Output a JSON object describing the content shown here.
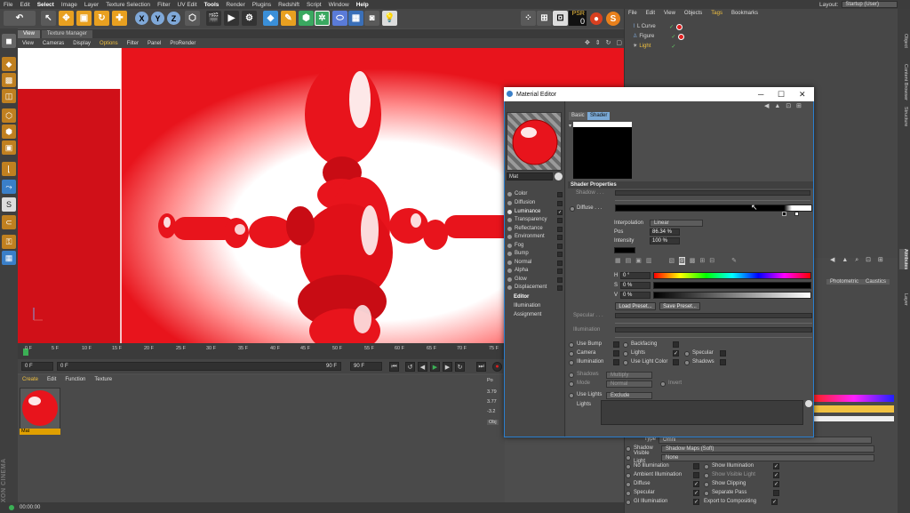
{
  "menubar": {
    "items": [
      "File",
      "Edit",
      "Select",
      "Image",
      "Layer",
      "Texture Selection",
      "Filter",
      "UV Edit",
      "Tools",
      "Render",
      "Plugins",
      "Redshift",
      "Script",
      "Window",
      "Help"
    ],
    "layout_label": "Layout:",
    "layout_value": "Startup (User)"
  },
  "toolbar": {
    "psr_label": "PSR",
    "psr_value": "0"
  },
  "viewport": {
    "tabs": [
      "View",
      "Texture Manager"
    ],
    "menu": [
      "View",
      "Cameras",
      "Display",
      "Options",
      "Filter",
      "Panel",
      "ProRender"
    ]
  },
  "timeline": {
    "ticks": [
      "0 F",
      "5 F",
      "10 F",
      "15 F",
      "20 F",
      "25 F",
      "30 F",
      "35 F",
      "40 F",
      "45 F",
      "50 F",
      "55 F",
      "60 F",
      "65 F",
      "70 F",
      "75 F"
    ],
    "start_frame": "0 F",
    "current_frame": "0 F",
    "end_a": "90 F",
    "end_b": "90 F"
  },
  "material_manager": {
    "menu": [
      "Create",
      "Edit",
      "Function",
      "Texture"
    ],
    "material_name": "Mat"
  },
  "coords": {
    "header": "Po",
    "x": "3.79",
    "y": "3.77",
    "z": "-3.2",
    "button": "Obj"
  },
  "brand": "MAXON CINEMA 4D",
  "statusbar": {
    "time": "00:00:00"
  },
  "object_manager": {
    "menu": [
      "File",
      "Edit",
      "View",
      "Objects",
      "Tags",
      "Bookmarks"
    ],
    "objects": [
      "L Curve",
      "Figure",
      "Light"
    ]
  },
  "side_tabs": [
    "Object",
    "Content Browser",
    "Structure",
    "Attributes",
    "Layer"
  ],
  "attributes": {
    "tabs_visible": [
      "Photometric",
      "Caustics"
    ],
    "type_label": "Type",
    "type_value": "Omni",
    "shadow_label": "Shadow",
    "shadow_value": "Shadow Maps (Soft)",
    "visible_light_label": "Visible Light",
    "visible_light_value": "None",
    "checks_left": [
      "No Illumination",
      "Ambient Illumination",
      "Diffuse",
      "Specular",
      "GI Illumination"
    ],
    "checks_right": [
      "Show Illumination",
      "Show Visible Light",
      "Show Clipping",
      "Separate Pass",
      "Export to Compositing"
    ]
  },
  "material_editor": {
    "title": "Material Editor",
    "material_name": "Mat",
    "tabs": [
      "Basic",
      "Shader"
    ],
    "channels": [
      "Color",
      "Diffusion",
      "Luminance",
      "Transparency",
      "Reflectance",
      "Environment",
      "Fog",
      "Bump",
      "Normal",
      "Alpha",
      "Glow",
      "Displacement"
    ],
    "extra_items": [
      "Editor",
      "Illumination",
      "Assignment"
    ],
    "section_title": "Shader Properties",
    "shadow_label": "Shadow . . .",
    "diffuse_label": "Diffuse . . .",
    "interpolation_label": "Interpolation",
    "interpolation_value": "Linear",
    "pos_label": "Pos",
    "pos_value": "86.34 %",
    "intensity_label": "Intensity",
    "intensity_value": "100 %",
    "h_label": "H",
    "h_value": "0 °",
    "s_label": "S",
    "s_value": "0 %",
    "v_label": "V",
    "v_value": "0 %",
    "load_preset": "Load Preset...",
    "save_preset": "Save Preset...",
    "specular_label": "Specular . . .",
    "illumination_label": "Illumination",
    "checks": {
      "use_bump": "Use Bump",
      "backfacing": "Backfacing",
      "camera": "Camera",
      "lights": "Lights",
      "specular": "Specular",
      "illumination": "Illumination",
      "use_light_color": "Use Light Color",
      "shadows": "Shadows"
    },
    "shadows_label": "Shadows",
    "shadows_value": "Multiply",
    "mode_label": "Mode",
    "mode_value": "Normal",
    "invert_label": "Invert",
    "use_lights_label": "Use Lights",
    "use_lights_value": "Exclude",
    "lights_label": "Lights"
  },
  "colors": {
    "accent": "#2a7fd0",
    "red": "#e8141c",
    "highlight_yellow": "#f0c040"
  }
}
